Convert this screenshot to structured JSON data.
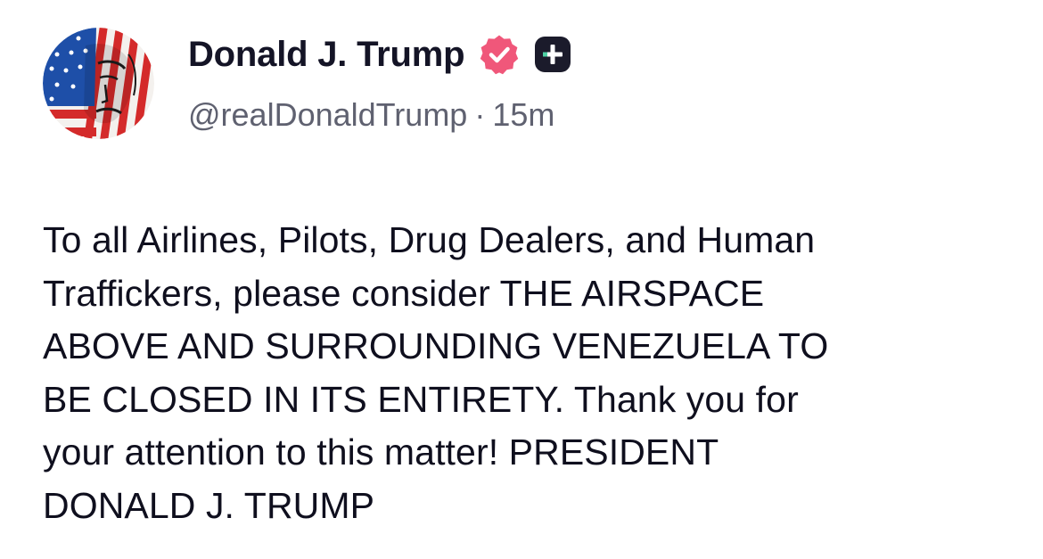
{
  "post": {
    "author": {
      "display_name": "Donald J. Trump",
      "handle": "@realDonaldTrump",
      "verified_icon": "verified-badge-icon",
      "plus_icon": "plus-badge-icon",
      "avatar": "flag-face-avatar"
    },
    "separator": "·",
    "timestamp": "15m",
    "lines": [
      "To all Airlines, Pilots, Drug Dealers, and Human",
      "Traffickers, please consider THE AIRSPACE",
      "ABOVE AND SURROUNDING VENEZUELA TO",
      "BE CLOSED IN ITS ENTIRETY. Thank you for",
      "your attention to this matter! PRESIDENT",
      "DONALD J. TRUMP"
    ]
  },
  "colors": {
    "verified": "#f0577a",
    "badge_dark": "#1b1b2b",
    "text": "#0f0f1e",
    "muted": "#5f6170",
    "flag_red": "#d42a2a",
    "flag_blue": "#1e4fa8"
  }
}
